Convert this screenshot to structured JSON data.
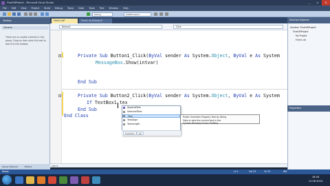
{
  "window": {
    "title": "FinalVBProject - Microsoft Visual Studio",
    "controls": [
      "_",
      "▫",
      "x"
    ]
  },
  "menu": [
    "File",
    "Edit",
    "View",
    "Project",
    "Build",
    "Debug",
    "Team",
    "Data",
    "Tools",
    "Test",
    "Window",
    "Help"
  ],
  "toolbar": {
    "config": "Debug",
    "platform": "webBrowser1"
  },
  "toolbox": {
    "title": "Toolbox",
    "group": "General",
    "message": "There are no usable controls in this group. Drag an item onto this text to add it to the toolbox.",
    "bottom_tabs": [
      "Server Explorer",
      "Toolbox"
    ]
  },
  "tabs": [
    "Form1.vb*",
    "Form1.vb [Design]*"
  ],
  "navbar": {
    "object": "Button2",
    "event": "Click"
  },
  "code": {
    "line1": {
      "kw1": "Private Sub ",
      "name": "Button1_Click(",
      "kw2": "ByVal",
      "rest": " sender ",
      "kw3": "As",
      "sp": " System.",
      "ty": "Object",
      "tail": ", ",
      "kw4": "ByVal",
      "end": " e ",
      "kw5": "As",
      "end2": " System"
    },
    "line2": {
      "ty": "MessageBox",
      "rest": ".Show(intvar)"
    },
    "line3": {
      "kw": "End Sub"
    },
    "line4": {
      "kw1": "Private Sub ",
      "name": "Button2_Click(",
      "kw2": "ByVal",
      "rest": " sender ",
      "kw3": "As",
      "sp": " System.",
      "ty": "Object",
      "tail": ", ",
      "kw4": "ByVal",
      "end": " e ",
      "kw5": "As",
      "end2": " System"
    },
    "line5": {
      "kw": "If ",
      "rest": "TextBox1.tex"
    },
    "line6": {
      "kw": "End Sub"
    },
    "line7": {
      "kw": "End Class"
    }
  },
  "intellisense": {
    "items": [
      "AppendText",
      "SelectedText",
      "Text",
      "TextAlign",
      "TextLength"
    ],
    "selected": "Text",
    "tabs": [
      "Common",
      "All"
    ],
    "tooltip_line1": "Public Overrides Property Text As String",
    "tooltip_line2": "Gets or sets the current text in the System.Windows.Forms.TextBox."
  },
  "zoom": "100 %",
  "status": {
    "state": "Ready",
    "ln": "Ln 1",
    "col": "Col 23",
    "ch": "Ch 23",
    "mode": "INS"
  },
  "solution": {
    "title": "Solution Explorer",
    "items": [
      "Solution 'FinalVBProject'",
      "FinalVBProject",
      "My Project",
      "Form1.vb"
    ]
  },
  "properties": {
    "title": "Properties"
  },
  "clock": {
    "time": "18:28",
    "date": "12.06.2014"
  },
  "colors": {
    "keyword": "#1f3fb3",
    "type": "#2b91af",
    "statusbar": "#2b5797"
  }
}
